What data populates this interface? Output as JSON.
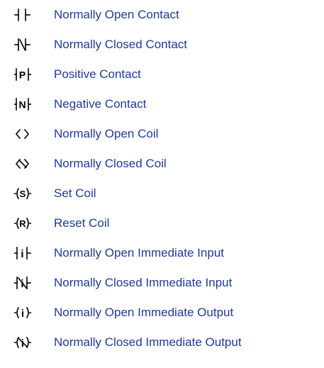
{
  "menu": {
    "items": [
      {
        "icon": "normally-open-contact-icon",
        "label": "Normally Open Contact"
      },
      {
        "icon": "normally-closed-contact-icon",
        "label": "Normally Closed Contact"
      },
      {
        "icon": "positive-contact-icon",
        "label": "Positive Contact"
      },
      {
        "icon": "negative-contact-icon",
        "label": "Negative Contact"
      },
      {
        "icon": "normally-open-coil-icon",
        "label": "Normally Open Coil"
      },
      {
        "icon": "normally-closed-coil-icon",
        "label": "Normally Closed Coil"
      },
      {
        "icon": "set-coil-icon",
        "label": "Set Coil"
      },
      {
        "icon": "reset-coil-icon",
        "label": "Reset Coil"
      },
      {
        "icon": "normally-open-immediate-input-icon",
        "label": "Normally Open Immediate Input"
      },
      {
        "icon": "normally-closed-immediate-input-icon",
        "label": "Normally Closed Immediate Input"
      },
      {
        "icon": "normally-open-immediate-output-icon",
        "label": "Normally Open Immediate Output"
      },
      {
        "icon": "normally-closed-immediate-output-icon",
        "label": "Normally Closed Immediate Output"
      }
    ],
    "icon_text": {
      "positive": "P",
      "negative": "N",
      "set": "S",
      "reset": "R",
      "immediate": "i"
    },
    "label_color": "#1f3a96",
    "icon_color": "#000000"
  }
}
